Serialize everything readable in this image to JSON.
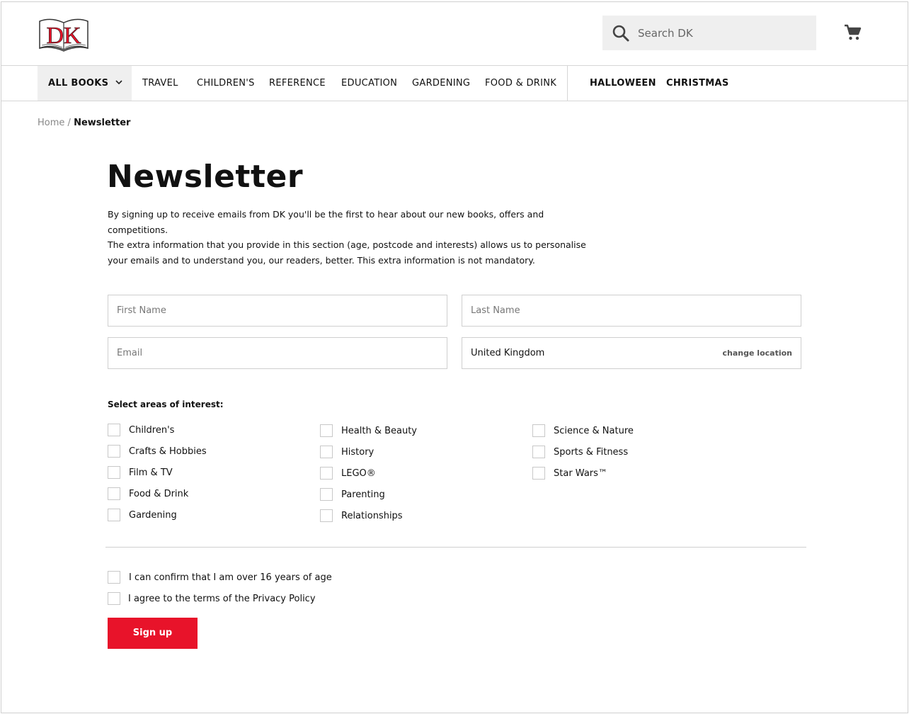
{
  "brand": {
    "logo_text": "DK",
    "accent_color": "#e8132a"
  },
  "header": {
    "search_placeholder": "Search DK",
    "search_icon": "search-icon",
    "cart_icon": "cart-icon"
  },
  "nav": {
    "all_books": "ALL BOOKS",
    "items": [
      "TRAVEL",
      "CHILDREN'S",
      "REFERENCE",
      "EDUCATION",
      "GARDENING",
      "FOOD & DRINK"
    ],
    "seasonal": [
      "HALLOWEEN",
      "CHRISTMAS"
    ]
  },
  "breadcrumb": {
    "home": "Home",
    "separator": "/",
    "current": "Newsletter"
  },
  "page": {
    "title": "Newsletter",
    "intro_1": "By signing up to receive emails from DK you'll be the first to hear about our new books, offers and competitions.",
    "intro_2": "The extra information that you provide in this section (age, postcode and interests) allows us to personalise your emails and to understand you, our readers, better. This extra information is not mandatory."
  },
  "form": {
    "first_name_placeholder": "First Name",
    "last_name_placeholder": "Last Name",
    "email_placeholder": "Email",
    "country": "United Kingdom",
    "change_location": "change location",
    "areas_label": "Select areas of interest:",
    "interests_col1": [
      "Children's",
      "Crafts & Hobbies",
      "Film & TV",
      "Food & Drink",
      "Gardening"
    ],
    "interests_col2": [
      "Health & Beauty",
      "History",
      "LEGO®",
      "Parenting",
      "Relationships"
    ],
    "interests_col3": [
      "Science & Nature",
      "Sports & Fitness",
      "Star Wars™"
    ],
    "confirm_age": "I can confirm that I am over 16 years of age",
    "agree_privacy": "I agree to the terms of the Privacy Policy",
    "submit_label": "Sign up"
  }
}
